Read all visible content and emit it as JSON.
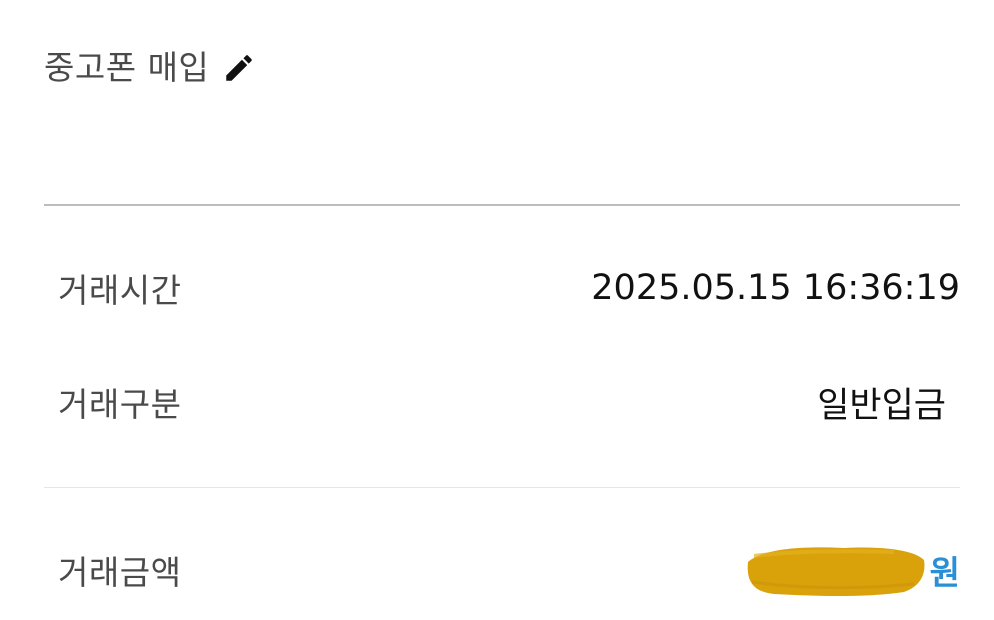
{
  "header": {
    "title": "중고폰 매입",
    "edit_icon": "pencil-icon"
  },
  "details": {
    "time": {
      "label": "거래시간",
      "value": "2025.05.15 16:36:19"
    },
    "type": {
      "label": "거래구분",
      "value": "일반입금"
    },
    "amount": {
      "label": "거래금액",
      "currency": "원",
      "redaction_color": "#d9a20a"
    }
  },
  "colors": {
    "label_text": "#4a4a4a",
    "value_text": "#111111",
    "currency_text": "#2b8fd6",
    "divider": "#bdbdbd"
  }
}
